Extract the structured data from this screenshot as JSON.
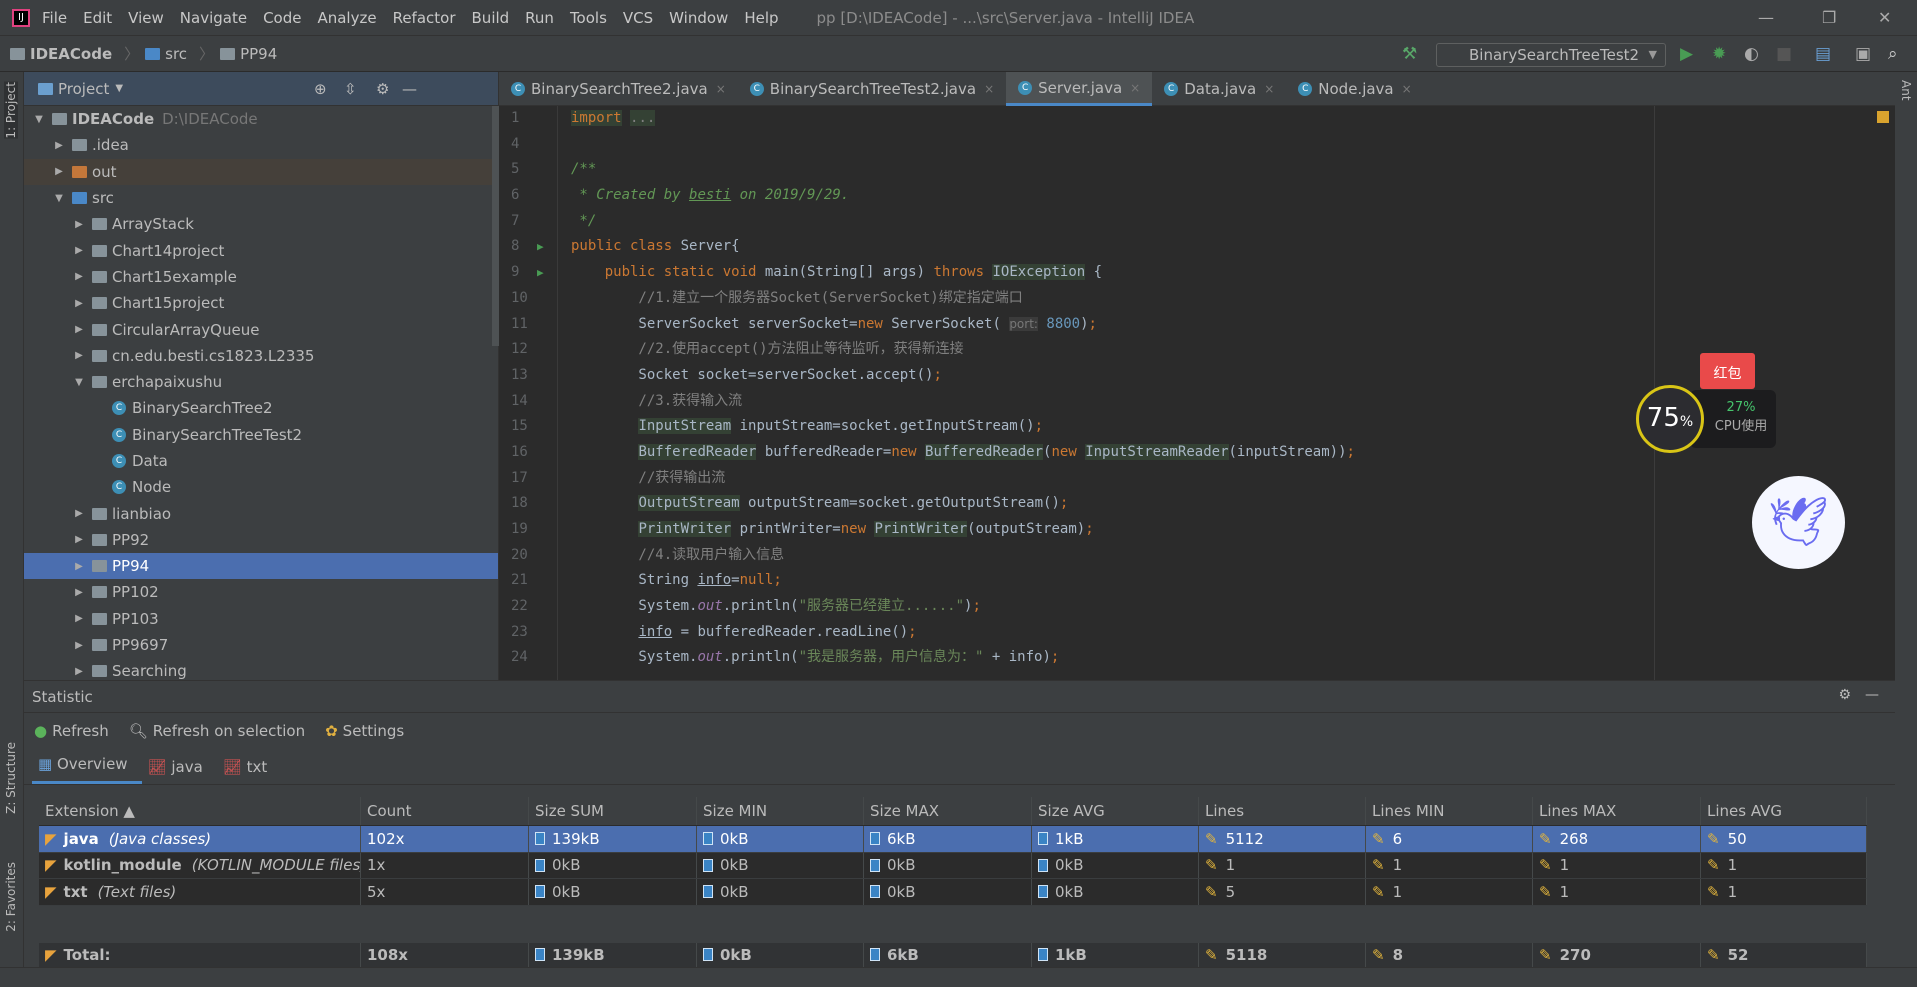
{
  "menubar": {
    "items": [
      "File",
      "Edit",
      "View",
      "Navigate",
      "Code",
      "Analyze",
      "Refactor",
      "Build",
      "Run",
      "Tools",
      "VCS",
      "Window",
      "Help"
    ],
    "title": "pp [D:\\IDEACode] - ...\\src\\Server.java - IntelliJ IDEA"
  },
  "breadcrumb": [
    "IDEACode",
    "src",
    "PP94"
  ],
  "run_config": "BinarySearchTreeTest2",
  "left_stripe": {
    "project": "1: Project",
    "structure": "Z: Structure",
    "favorites": "2: Favorites"
  },
  "right_stripe": {
    "ant": "Ant"
  },
  "project": {
    "title": "Project",
    "tree": [
      {
        "label": "IDEACode",
        "extra": "D:\\IDEACode",
        "level": 0,
        "kind": "module",
        "open": true
      },
      {
        "label": ".idea",
        "level": 1,
        "kind": "folder"
      },
      {
        "label": "out",
        "level": 1,
        "kind": "folder-orange"
      },
      {
        "label": "src",
        "level": 1,
        "kind": "folder-blue",
        "open": true
      },
      {
        "label": "ArrayStack",
        "level": 2,
        "kind": "package"
      },
      {
        "label": "Chart14project",
        "level": 2,
        "kind": "package"
      },
      {
        "label": "Chart15example",
        "level": 2,
        "kind": "package"
      },
      {
        "label": "Chart15project",
        "level": 2,
        "kind": "package"
      },
      {
        "label": "CircularArrayQueue",
        "level": 2,
        "kind": "package"
      },
      {
        "label": "cn.edu.besti.cs1823.L2335",
        "level": 2,
        "kind": "package"
      },
      {
        "label": "erchapaixushu",
        "level": 2,
        "kind": "package",
        "open": true
      },
      {
        "label": "BinarySearchTree2",
        "level": 3,
        "kind": "class"
      },
      {
        "label": "BinarySearchTreeTest2",
        "level": 3,
        "kind": "class"
      },
      {
        "label": "Data",
        "level": 3,
        "kind": "class"
      },
      {
        "label": "Node",
        "level": 3,
        "kind": "class"
      },
      {
        "label": "lianbiao",
        "level": 2,
        "kind": "package"
      },
      {
        "label": "PP92",
        "level": 2,
        "kind": "package"
      },
      {
        "label": "PP94",
        "level": 2,
        "kind": "package",
        "selected": true
      },
      {
        "label": "PP102",
        "level": 2,
        "kind": "package"
      },
      {
        "label": "PP103",
        "level": 2,
        "kind": "package"
      },
      {
        "label": "PP9697",
        "level": 2,
        "kind": "package"
      },
      {
        "label": "Searching",
        "level": 2,
        "kind": "package"
      }
    ]
  },
  "editor": {
    "tabs": [
      {
        "label": "BinarySearchTree2.java",
        "close": "×"
      },
      {
        "label": "BinarySearchTreeTest2.java",
        "close": "×"
      },
      {
        "label": "Server.java",
        "close": "×",
        "active": true
      },
      {
        "label": "Data.java",
        "close": "×"
      },
      {
        "label": "Node.java",
        "close": "×"
      }
    ],
    "lines": [
      {
        "n": "1",
        "t": [
          [
            "import",
            "kw hl"
          ],
          [
            " ",
            ""
          ],
          [
            "...",
            "cm hl"
          ]
        ]
      },
      {
        "n": "4",
        "t": []
      },
      {
        "n": "5",
        "t": [
          [
            "/**",
            "doc"
          ]
        ]
      },
      {
        "n": "6",
        "t": [
          [
            " * Created by ",
            "doc"
          ],
          [
            "besti",
            "doc ul"
          ],
          [
            " on 2019/9/29.",
            "doc"
          ]
        ]
      },
      {
        "n": "7",
        "t": [
          [
            " */",
            "doc"
          ]
        ]
      },
      {
        "n": "8",
        "run": true,
        "t": [
          [
            "public class ",
            "kw"
          ],
          [
            "Server{",
            ""
          ]
        ]
      },
      {
        "n": "9",
        "run": true,
        "t": [
          [
            "    public static void ",
            "kw"
          ],
          [
            "main(String[] args) ",
            ""
          ],
          [
            "throws ",
            "kw"
          ],
          [
            "IOException",
            "hl"
          ],
          [
            " {",
            ""
          ]
        ]
      },
      {
        "n": "10",
        "t": [
          [
            "        //1.建立一个服务器Socket(ServerSocket)绑定指定端口",
            "cm"
          ]
        ]
      },
      {
        "n": "11",
        "t": [
          [
            "        ServerSocket serverSocket=",
            ""
          ],
          [
            "new ",
            "kw"
          ],
          [
            "ServerSocket( ",
            ""
          ],
          [
            "port:",
            "hint"
          ],
          [
            " ",
            ""
          ],
          [
            "8800",
            "num"
          ],
          [
            ")",
            ""
          ],
          [
            ";",
            "kw"
          ]
        ]
      },
      {
        "n": "12",
        "t": [
          [
            "        //2.使用accept()方法阻止等待监听，获得新连接",
            "cm"
          ]
        ]
      },
      {
        "n": "13",
        "t": [
          [
            "        Socket socket=serverSocket.accept()",
            ""
          ],
          [
            ";",
            "kw"
          ]
        ]
      },
      {
        "n": "14",
        "t": [
          [
            "        //3.获得输入流",
            "cm"
          ]
        ]
      },
      {
        "n": "15",
        "t": [
          [
            "        ",
            ""
          ],
          [
            "InputStream",
            "hl"
          ],
          [
            " inputStream=socket.getInputStream()",
            ""
          ],
          [
            ";",
            "kw"
          ]
        ]
      },
      {
        "n": "16",
        "t": [
          [
            "        ",
            ""
          ],
          [
            "BufferedReader",
            "hl"
          ],
          [
            " bufferedReader=",
            ""
          ],
          [
            "new ",
            "kw"
          ],
          [
            "BufferedReader",
            "hl"
          ],
          [
            "(",
            ""
          ],
          [
            "new ",
            "kw"
          ],
          [
            "InputStreamReader",
            "hl"
          ],
          [
            "(inputStream))",
            ""
          ],
          [
            ";",
            "kw"
          ]
        ]
      },
      {
        "n": "17",
        "t": [
          [
            "        //获得输出流",
            "cm"
          ]
        ]
      },
      {
        "n": "18",
        "t": [
          [
            "        ",
            ""
          ],
          [
            "OutputStream",
            "hl"
          ],
          [
            " outputStream=socket.getOutputStream()",
            ""
          ],
          [
            ";",
            "kw"
          ]
        ]
      },
      {
        "n": "19",
        "t": [
          [
            "        ",
            ""
          ],
          [
            "PrintWriter",
            "hl"
          ],
          [
            " printWriter=",
            ""
          ],
          [
            "new ",
            "kw"
          ],
          [
            "PrintWriter",
            "hl"
          ],
          [
            "(outputStream)",
            ""
          ],
          [
            ";",
            "kw"
          ]
        ]
      },
      {
        "n": "20",
        "t": [
          [
            "        //4.读取用户输入信息",
            "cm"
          ]
        ]
      },
      {
        "n": "21",
        "t": [
          [
            "        String ",
            ""
          ],
          [
            "info",
            "ul"
          ],
          [
            "=",
            ""
          ],
          [
            "null",
            "kw"
          ],
          [
            ";",
            "kw"
          ]
        ]
      },
      {
        "n": "22",
        "t": [
          [
            "        System.",
            ""
          ],
          [
            "out",
            "it"
          ],
          [
            ".println(",
            ""
          ],
          [
            "\"服务器已经建立......\"",
            "str"
          ],
          [
            ")",
            ""
          ],
          [
            ";",
            "kw"
          ]
        ]
      },
      {
        "n": "23",
        "t": [
          [
            "        ",
            ""
          ],
          [
            "info",
            "ul"
          ],
          [
            " = bufferedReader.readLine()",
            ""
          ],
          [
            ";",
            "kw"
          ]
        ]
      },
      {
        "n": "24",
        "t": [
          [
            "        System.",
            ""
          ],
          [
            "out",
            "it"
          ],
          [
            ".println(",
            ""
          ],
          [
            "\"我是服务器，用户信息为：\"",
            "str"
          ],
          [
            " + info)",
            ""
          ],
          [
            ";",
            "kw"
          ]
        ]
      }
    ]
  },
  "statistic": {
    "title": "Statistic",
    "toolbar": {
      "refresh": "Refresh",
      "refresh_selection": "Refresh on selection",
      "settings": "Settings"
    },
    "tabs": [
      {
        "label": "Overview",
        "active": true
      },
      {
        "label": "java"
      },
      {
        "label": "txt"
      }
    ],
    "columns": [
      "Extension ▲",
      "Count",
      "Size SUM",
      "Size MIN",
      "Size MAX",
      "Size AVG",
      "Lines",
      "Lines MIN",
      "Lines MAX",
      "Lines AVG"
    ],
    "rows": [
      {
        "ext": "java",
        "desc": "(Java classes)",
        "cells": [
          "102x",
          "139kB",
          "0kB",
          "6kB",
          "1kB",
          "5112",
          "6",
          "268",
          "50"
        ],
        "selected": true
      },
      {
        "ext": "kotlin_module",
        "desc": "(KOTLIN_MODULE files)",
        "cells": [
          "1x",
          "0kB",
          "0kB",
          "0kB",
          "0kB",
          "1",
          "1",
          "1",
          "1"
        ]
      },
      {
        "ext": "txt",
        "desc": "(Text files)",
        "cells": [
          "5x",
          "0kB",
          "0kB",
          "0kB",
          "0kB",
          "5",
          "1",
          "1",
          "1"
        ]
      }
    ],
    "total": {
      "ext": "Total:",
      "cells": [
        "108x",
        "139kB",
        "0kB",
        "6kB",
        "1kB",
        "5118",
        "8",
        "270",
        "52"
      ]
    }
  },
  "overlay": {
    "cpu_ring": "75",
    "cpu_ring_unit": "%",
    "cpu_percent": "27%",
    "cpu_label": "CPU使用",
    "red_packet": "红包"
  },
  "colors": {
    "accent": "#4a88c7",
    "selection": "#4b6eaf",
    "background": "#2b2b2b",
    "panel": "#3c3f41"
  }
}
